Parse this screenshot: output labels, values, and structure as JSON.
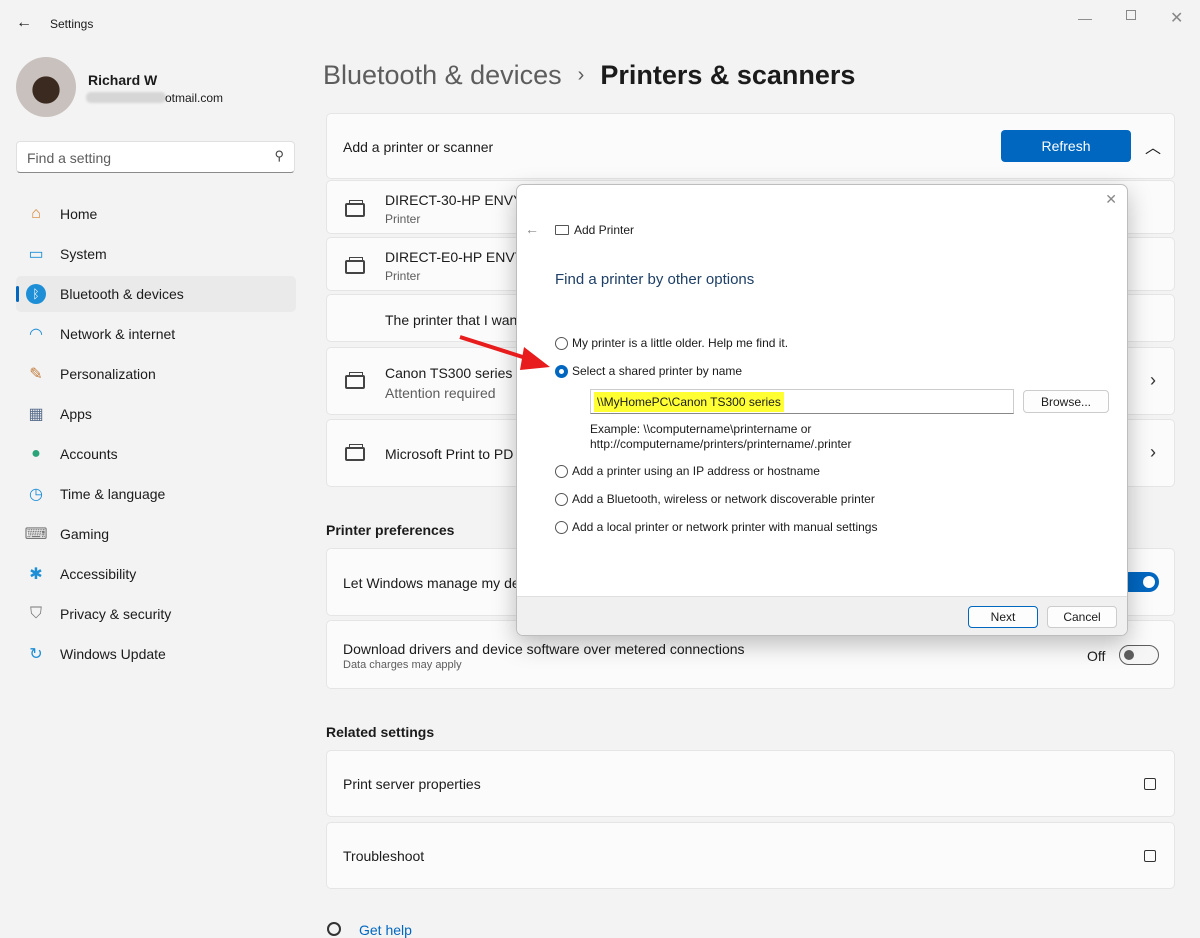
{
  "window": {
    "title": "Settings"
  },
  "user": {
    "name": "Richard W",
    "email": "otmail.com"
  },
  "search": {
    "placeholder": "Find a setting"
  },
  "nav": [
    {
      "label": "Home",
      "icon": "home-icon"
    },
    {
      "label": "System",
      "icon": "system-icon"
    },
    {
      "label": "Bluetooth & devices",
      "icon": "bluetooth-icon",
      "selected": true
    },
    {
      "label": "Network & internet",
      "icon": "wifi-icon"
    },
    {
      "label": "Personalization",
      "icon": "brush-icon"
    },
    {
      "label": "Apps",
      "icon": "apps-icon"
    },
    {
      "label": "Accounts",
      "icon": "accounts-icon"
    },
    {
      "label": "Time & language",
      "icon": "clock-icon"
    },
    {
      "label": "Gaming",
      "icon": "gamepad-icon"
    },
    {
      "label": "Accessibility",
      "icon": "accessibility-icon"
    },
    {
      "label": "Privacy & security",
      "icon": "shield-icon"
    },
    {
      "label": "Windows Update",
      "icon": "update-icon"
    }
  ],
  "breadcrumb": {
    "parent": "Bluetooth & devices",
    "sep": "›",
    "current": "Printers & scanners"
  },
  "add_card": {
    "label": "Add a printer or scanner",
    "refresh": "Refresh"
  },
  "found": [
    {
      "name": "DIRECT-30-HP ENVY",
      "type": "Printer"
    },
    {
      "name": "DIRECT-E0-HP ENVY",
      "type": "Printer"
    }
  ],
  "not_listed": "The printer that I wan",
  "printers": [
    {
      "name": "Canon TS300 series",
      "status": "Attention required"
    },
    {
      "name": "Microsoft Print to PD",
      "status": ""
    }
  ],
  "prefs": {
    "heading": "Printer preferences",
    "manage": {
      "label": "Let Windows manage my de",
      "on": true
    },
    "metered": {
      "label": "Download drivers and device software over metered connections",
      "sub": "Data charges may apply",
      "state": "Off",
      "on": false
    }
  },
  "related": {
    "heading": "Related settings",
    "items": [
      "Print server properties",
      "Troubleshoot"
    ]
  },
  "help": "Get help",
  "dialog": {
    "title": "Add Printer",
    "heading": "Find a printer by other options",
    "options": [
      "My printer is a little older. Help me find it.",
      "Select a shared printer by name",
      "Add a printer using an IP address or hostname",
      "Add a Bluetooth, wireless or network discoverable printer",
      "Add a local printer or network printer with manual settings"
    ],
    "selected_index": 1,
    "shared_value": "\\\\MyHomePC\\Canon TS300 series",
    "browse": "Browse...",
    "example1": "Example: \\\\computername\\printername or",
    "example2": "http://computername/printers/printername/.printer",
    "next": "Next",
    "cancel": "Cancel"
  },
  "colors": {
    "accent": "#0067c0",
    "highlight": "#ffff33",
    "arrow": "#e81c1c"
  }
}
